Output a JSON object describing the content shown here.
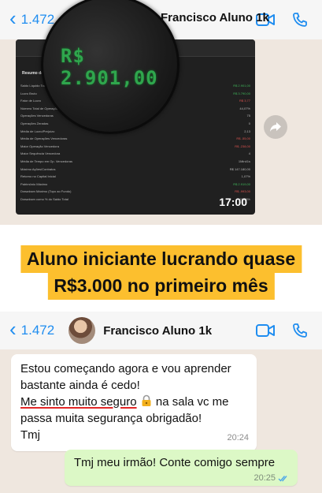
{
  "top_chat": {
    "back_count": "1.472",
    "contact_name": "Francisco Aluno 1k",
    "magnified_value": "R$ 2.901,00",
    "video_time": "17:00",
    "video_section_title": "Resumo de",
    "video_rows": [
      {
        "l": "Saldo Líquido Total",
        "r": "R$ 2.901,00",
        "c": "vg"
      },
      {
        "l": "Lucro Bruto",
        "r": "R$ 3.790,00",
        "c": "vg"
      },
      {
        "l": "Fator de Lucro",
        "r": "R$ 3,77",
        "c": "vr"
      },
      {
        "l": "Número Total de Operações",
        "r": "44,07%",
        "c": ""
      },
      {
        "l": "Operações Vencedoras",
        "r": "75",
        "c": ""
      },
      {
        "l": "Operações Zeradas",
        "r": "0",
        "c": ""
      },
      {
        "l": "Média de Lucro/Prejuízo",
        "r": "2,13",
        "c": ""
      },
      {
        "l": "Média de Operações Vencedoras",
        "r": "R$ -55,00",
        "c": "vr"
      },
      {
        "l": "Maior Operação Vencedora",
        "r": "R$ -238,00",
        "c": "vr"
      },
      {
        "l": "Maior Sequência Vencedora",
        "r": "4",
        "c": ""
      },
      {
        "l": "Média de Tempo em Op. Vencedoras",
        "r": "1Min41s",
        "c": ""
      },
      {
        "l": "Máximo Ações/Contratos",
        "r": "R$ 147.180,00",
        "c": ""
      },
      {
        "l": "Retorno no Capital Inicial",
        "r": "1,07%",
        "c": ""
      },
      {
        "l": "Patrimônio Máximo",
        "r": "R$ 2.919,00",
        "c": "vg"
      },
      {
        "l": "Drawdown Máximo (Topo ao Fundo)",
        "r": "R$ -993,00",
        "c": "vr"
      },
      {
        "l": "Drawdown como % do Saldo Total",
        "r": "25,83%",
        "c": ""
      }
    ]
  },
  "caption": {
    "line1": "Aluno iniciante lucrando quase",
    "line2": "R$3.000 no primeiro mês"
  },
  "bottom_chat": {
    "back_count": "1.472",
    "contact_name": "Francisco Aluno 1k",
    "incoming": {
      "line1": "Estou começando agora e vou aprender",
      "line2": "bastante ainda é cedo!",
      "line3_underlined": "Me sinto muito seguro",
      "line3_rest": "na sala vc me",
      "line4": "passa muita segurança obrigadão!",
      "line5": "Tmj",
      "time": "20:24"
    },
    "outgoing": {
      "text": "Tmj meu irmão! Conte comigo sempre",
      "time": "20:25"
    }
  },
  "colors": {
    "whatsapp_blue": "#1f8df0",
    "chat_background": "#efe7df",
    "outgoing_bubble": "#dcf8c6",
    "caption_highlight": "#fcbf2e",
    "money_green": "#2fa64d",
    "underline_red": "#e12727"
  },
  "icons": [
    "chevron-left-icon",
    "video-call-icon",
    "phone-icon",
    "share-icon",
    "lock-icon",
    "double-check-icon"
  ]
}
